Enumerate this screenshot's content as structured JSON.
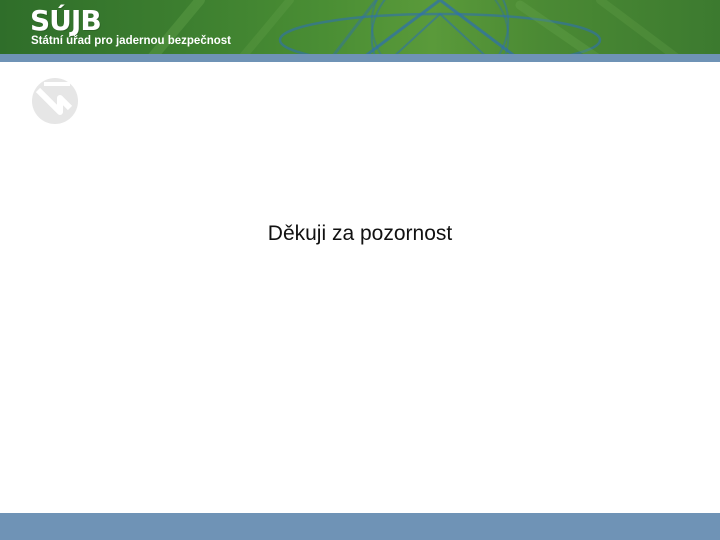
{
  "header": {
    "logo_text": "SÚJB",
    "org_name": "Státní úřad pro jadernou bezpečnost"
  },
  "slide": {
    "thanks_text": "Děkuji za pozornost"
  },
  "colors": {
    "header_green": "#3c7e2f",
    "band_blue": "#6f93b6",
    "watermark_gray": "#e6e6e6"
  },
  "icons": {
    "watermark": "sujb-logo-watermark-icon"
  }
}
